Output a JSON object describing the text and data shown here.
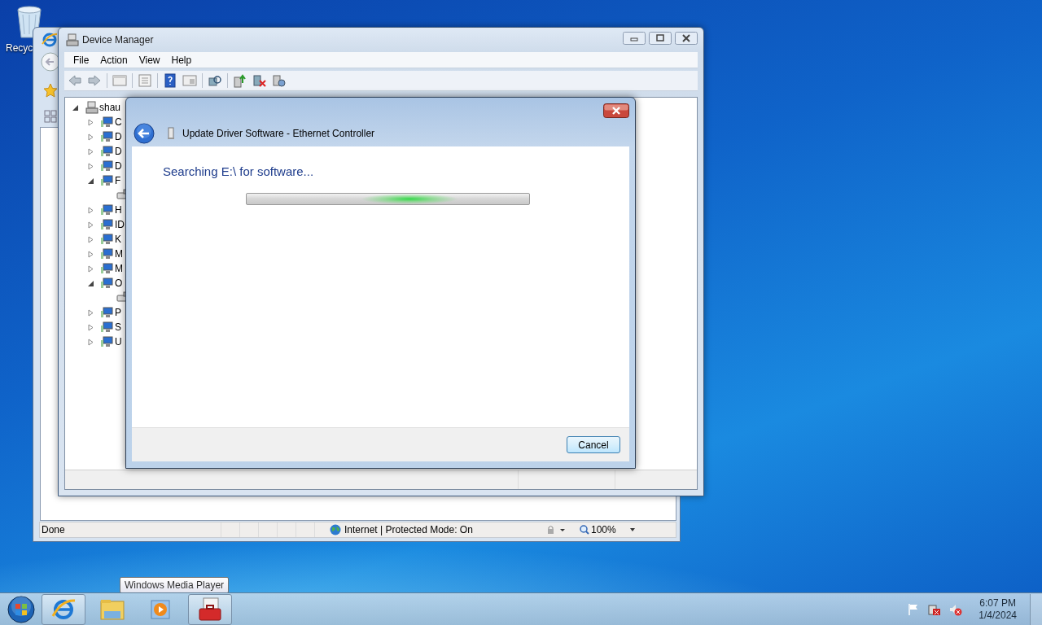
{
  "desktop_icons": [
    {
      "label": "Recyc"
    }
  ],
  "browser_window": {
    "status_bar": {
      "status": "Done",
      "zone": "Internet | Protected Mode: On",
      "zoom": "100%"
    }
  },
  "device_manager": {
    "title": "Device Manager",
    "menu": [
      "File",
      "Action",
      "View",
      "Help"
    ],
    "tree": [
      {
        "label": "shau",
        "expanded": true,
        "children": [
          {
            "label": "C",
            "expanded": false
          },
          {
            "label": "D",
            "expanded": false
          },
          {
            "label": "D",
            "expanded": false
          },
          {
            "label": "D",
            "expanded": false
          },
          {
            "label": "F",
            "expanded": true,
            "children": [
              {
                "kind": "device"
              }
            ]
          },
          {
            "label": "H",
            "expanded": false
          },
          {
            "label": "ID",
            "expanded": false
          },
          {
            "label": "K",
            "expanded": false
          },
          {
            "label": "M",
            "expanded": false
          },
          {
            "label": "M",
            "expanded": false
          },
          {
            "label": "O",
            "expanded": true,
            "children": [
              {
                "kind": "device"
              }
            ]
          },
          {
            "label": "P",
            "expanded": false
          },
          {
            "label": "S",
            "expanded": false
          },
          {
            "label": "U",
            "expanded": false
          }
        ]
      }
    ]
  },
  "dialog": {
    "title": "Update Driver Software - Ethernet Controller",
    "heading": "Searching E:\\ for software...",
    "progress": {
      "indeterminate": true
    },
    "buttons": [
      "Cancel"
    ]
  },
  "tooltip": "Windows Media Player",
  "taskbar": {
    "items": [
      {
        "kind": "browser",
        "running": true
      },
      {
        "kind": "folder",
        "running": false
      },
      {
        "kind": "media",
        "running": false
      },
      {
        "kind": "toolbox",
        "running": true
      }
    ],
    "clock": {
      "time": "6:07 PM",
      "date": "1/4/2024"
    }
  }
}
